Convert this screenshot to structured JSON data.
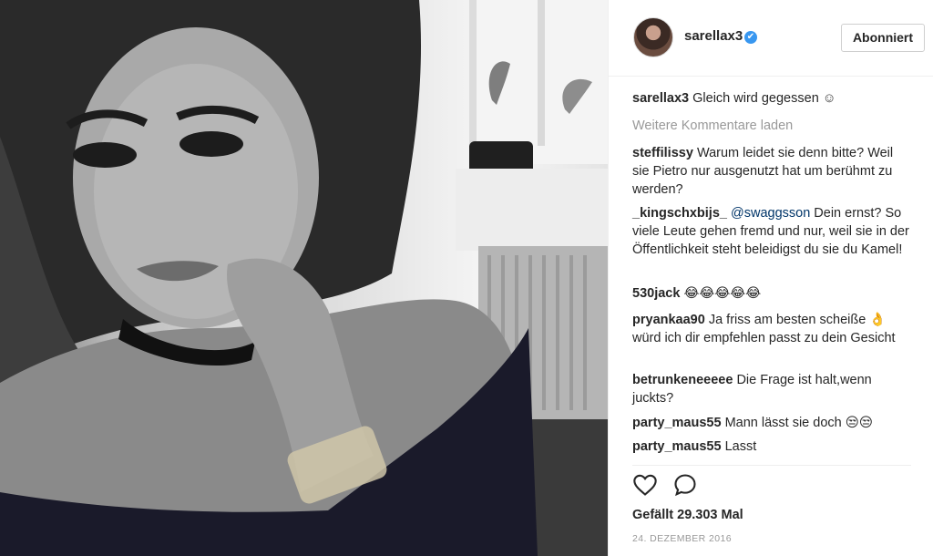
{
  "post": {
    "photo_alt": "selfie photo",
    "header": {
      "username": "sarellax3",
      "verified_mark": "✔",
      "follow_label": "Abonniert"
    },
    "caption": {
      "username": "sarellax3",
      "text": "Gleich wird gegessen ☺"
    },
    "load_more": "Weitere Kommentare laden",
    "comments": [
      {
        "username": "steffilissy",
        "text": "Warum leidet sie denn bitte? Weil sie Pietro nur ausgenutzt hat um berühmt zu werden?"
      },
      {
        "username": "_kingschxbijs_",
        "mention": "@swaggsson",
        "text": "Dein ernst? So viele Leute gehen fremd und nur, weil sie in der Öffentlichkeit steht beleidigst du sie du Kamel!"
      },
      {
        "username": "530jack",
        "text": "😂😂😂😂😂"
      },
      {
        "username": "pryankaa90",
        "text": "Ja friss am besten scheiße 👌 würd ich dir empfehlen passt zu dein Gesicht"
      },
      {
        "username": "betrunkeneeeee",
        "text": "Die Frage ist halt,wenn juckts?"
      },
      {
        "username": "party_maus55",
        "text": "Mann lässt sie doch 😒😒"
      },
      {
        "username": "party_maus55",
        "text": "Lasst"
      }
    ],
    "likes": "Gefällt 29.303 Mal",
    "date": "24. DEZEMBER 2016",
    "icons": {
      "like": "heart-icon",
      "comment": "comment-bubble-icon"
    }
  }
}
